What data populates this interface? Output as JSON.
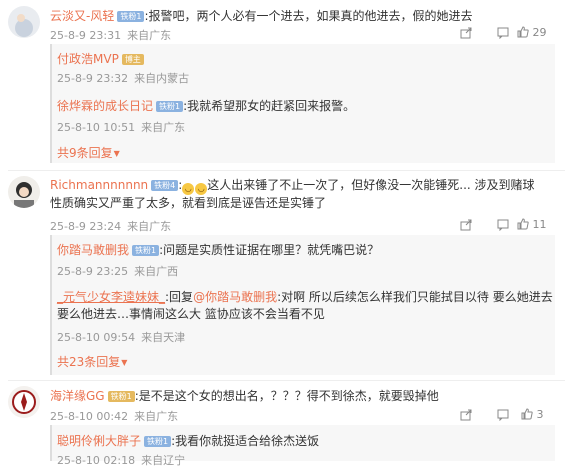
{
  "comments": [
    {
      "user": "云淡又-风轻",
      "badge": "铁粉1",
      "text": ":报警吧，两个人必有一个进去，如果真的他进去，假的她进去",
      "time": "25-8-9 23:31",
      "location": "来自广东",
      "likes": "29",
      "replies": [
        {
          "user": "付政浩MVP",
          "badge": "博主",
          "text": "",
          "time": "25-8-9 23:32",
          "location": "来自内蒙古"
        },
        {
          "user": "徐烨霖的成长日记",
          "badge": "铁粉1",
          "text": ":我就希望那女的赶紧回来报警。",
          "time": "25-8-10 10:51",
          "location": "来自广东"
        }
      ],
      "more": "共9条回复"
    },
    {
      "user": "Richmannnnnnn",
      "badge": "铁粉4",
      "text_a": "这人出来锤了不止一次了，但好像没一次能锤死...  涉及到赌球",
      "text_b": "性质确实又严重了太多，就看到底是诬告还是实锤了",
      "time": "25-8-9 23:24",
      "location": "来自广东",
      "likes": "11",
      "replies": [
        {
          "user": "你踏马敢删我",
          "badge": "铁粉1",
          "text": ":问题是实质性证据在哪里？就凭嘴巴说？",
          "time": "25-8-9 23:25",
          "location": "来自广西"
        },
        {
          "user": "_元气少女李逵妹妹_",
          "reply_prefix": ":回复",
          "reply_target": "@你踏马敢删我",
          "text_a": ":对啊 所以后续怎么样我们只能拭目以待 要么她进去",
          "text_b": "要么他进去…事情闹这么大 篮协应该不会当看不见",
          "time": "25-8-10 09:54",
          "location": "来自天津"
        }
      ],
      "more": "共23条回复"
    },
    {
      "user": "海洋缘GG",
      "badge": "铁粉1",
      "text": ":是不是这个女的想出名，？？？得不到徐杰，就要毁掉他",
      "time": "25-8-10 00:42",
      "location": "来自广东",
      "likes": "3",
      "replies": [
        {
          "user": "聪明伶俐大胖子",
          "badge": "铁粉1",
          "text": ":我看你就挺适合给徐杰送饭",
          "time": "25-8-10 02:18",
          "location": "来自辽宁"
        }
      ]
    }
  ],
  "colors": {
    "username": "#eb7350",
    "meta": "#999999",
    "reply_bg": "#f7f7f7"
  },
  "icons": [
    "share-icon",
    "comment-icon",
    "like-icon"
  ]
}
